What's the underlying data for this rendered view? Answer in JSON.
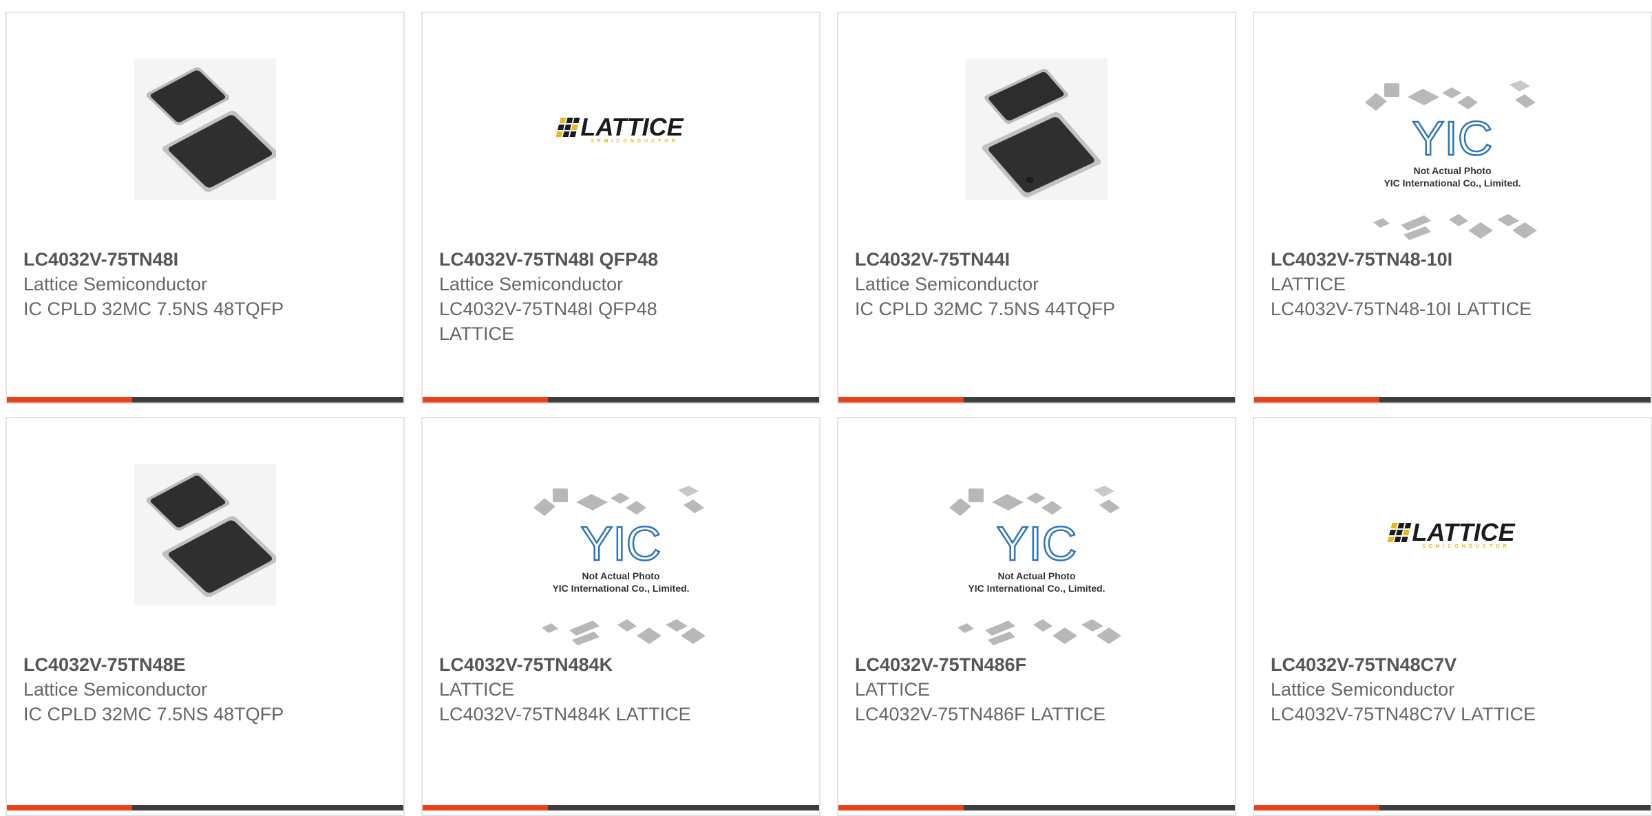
{
  "products": [
    {
      "part_number": "LC4032V-75TN48I",
      "manufacturer": "Lattice Semiconductor",
      "description": "IC CPLD 32MC 7.5NS 48TQFP",
      "image": "chip-photo-icon"
    },
    {
      "part_number": "LC4032V-75TN48I QFP48",
      "manufacturer": "Lattice Semiconductor",
      "description": "LC4032V-75TN48I QFP48 LATTICE",
      "image": "lattice-logo-icon"
    },
    {
      "part_number": "LC4032V-75TN44I",
      "manufacturer": "Lattice Semiconductor",
      "description": "IC CPLD 32MC 7.5NS 44TQFP",
      "image": "chip-photo-icon"
    },
    {
      "part_number": "LC4032V-75TN48-10I",
      "manufacturer": "LATTICE",
      "description": "LC4032V-75TN48-10I LATTICE",
      "image": "yic-placeholder-icon"
    },
    {
      "part_number": "LC4032V-75TN48E",
      "manufacturer": "Lattice Semiconductor",
      "description": "IC CPLD 32MC 7.5NS 48TQFP",
      "image": "chip-photo-icon"
    },
    {
      "part_number": "LC4032V-75TN484K",
      "manufacturer": "LATTICE",
      "description": "LC4032V-75TN484K LATTICE",
      "image": "yic-placeholder-icon"
    },
    {
      "part_number": "LC4032V-75TN486F",
      "manufacturer": "LATTICE",
      "description": "LC4032V-75TN486F LATTICE",
      "image": "yic-placeholder-icon"
    },
    {
      "part_number": "LC4032V-75TN48C7V",
      "manufacturer": "Lattice Semiconductor",
      "description": "LC4032V-75TN48C7V LATTICE",
      "image": "lattice-logo-icon"
    }
  ],
  "placeholder": {
    "line1": "Not Actual Photo",
    "line2": "YIC International Co., Limited.",
    "brand": "YIC"
  },
  "logo": {
    "word": "LATTICE",
    "sub": "SEMICONDUCTOR"
  },
  "colors": {
    "accent": "#e8421b",
    "bar": "#3e3e3e",
    "border": "#e4e4e4",
    "title": "#555555",
    "text": "#666666",
    "logo_yellow": "#f1b31a"
  }
}
